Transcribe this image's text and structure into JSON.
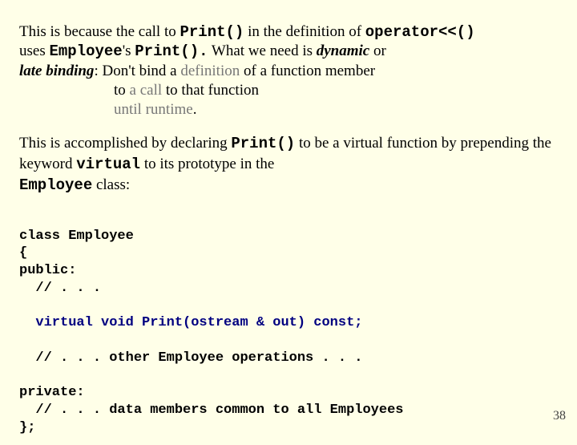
{
  "p1": {
    "a": "This is because the call to ",
    "print1": "Print()",
    "b": " in the definition of ",
    "opcall": "operator<<()",
    "c": "uses ",
    "emp": "Employee",
    "d": "'s ",
    "print2": "Print().",
    "e": "  What we need is ",
    "dyn": "dynamic",
    "f": " or",
    "late": "late binding",
    "g": ":   Don't bind a ",
    "defn": "definition",
    "h": " of a function member",
    "i": "to ",
    "call": "a call",
    "j": " to that function",
    "k": "until runtime",
    "l": "."
  },
  "p2": {
    "a": "This is accomplished by declaring ",
    "print": "Print()",
    "b": " to be a ",
    "vf": "virtual function",
    "c": " by prepending the keyword ",
    "kw": "virtual",
    "d": " to its prototype in the ",
    "emp": "Employee",
    "e": " class:"
  },
  "code": {
    "l1": "class Employee",
    "l2": "{",
    "l3": "public:",
    "l4": "  // . . .",
    "l5": "  virtual void Print(ostream & out) const;",
    "l6": "  // . . . other Employee operations . . .",
    "l7": "private:",
    "l8": "  // . . . data members common to all Employees",
    "l9": "};"
  },
  "pagenum": "38"
}
